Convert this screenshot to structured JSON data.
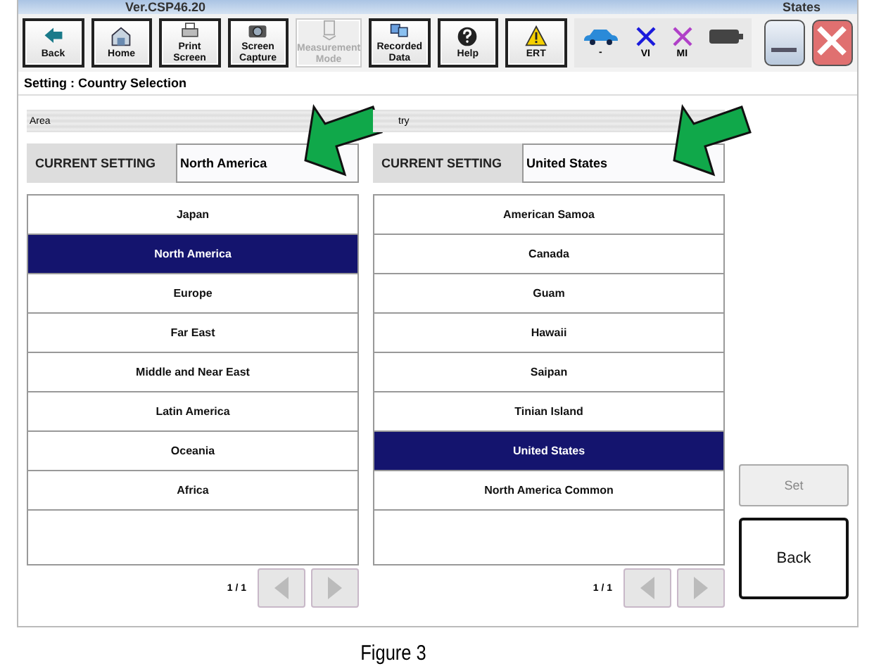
{
  "window": {
    "title": "Ver.CSP46.20",
    "title_right": "States"
  },
  "toolbar": [
    {
      "label": "Back",
      "kind": "back",
      "disabled": false
    },
    {
      "label": "Home",
      "kind": "home",
      "disabled": false
    },
    {
      "label": "Print Screen",
      "kind": "print",
      "disabled": false
    },
    {
      "label": "Screen Capture",
      "kind": "camera",
      "disabled": false
    },
    {
      "label": "Measurement Mode",
      "kind": "measure",
      "disabled": true
    },
    {
      "label": "Recorded Data",
      "kind": "data",
      "disabled": false
    },
    {
      "label": "Help",
      "kind": "help",
      "disabled": false
    },
    {
      "label": "ERT",
      "kind": "warning",
      "disabled": false
    }
  ],
  "status": [
    {
      "kind": "car",
      "label": "-"
    },
    {
      "kind": "x",
      "label": "VI",
      "color": "#1a1adc"
    },
    {
      "kind": "x",
      "label": "MI",
      "color": "#b040c8"
    },
    {
      "kind": "battery"
    }
  ],
  "screen_title": "Setting : Country Selection",
  "panels": [
    {
      "header": "Area",
      "current_label": "CURRENT SETTING",
      "current_value": "North America",
      "page": "1 / 1",
      "items": [
        {
          "label": "Japan",
          "selected": false
        },
        {
          "label": "North America",
          "selected": true
        },
        {
          "label": "Europe",
          "selected": false
        },
        {
          "label": "Far East",
          "selected": false
        },
        {
          "label": "Middle and Near East",
          "selected": false
        },
        {
          "label": "Latin America",
          "selected": false
        },
        {
          "label": "Oceania",
          "selected": false
        },
        {
          "label": "Africa",
          "selected": false
        }
      ]
    },
    {
      "header": "try",
      "current_label": "CURRENT SETTING",
      "current_value": "United States",
      "page": "1 / 1",
      "items": [
        {
          "label": "American Samoa",
          "selected": false
        },
        {
          "label": "Canada",
          "selected": false
        },
        {
          "label": "Guam",
          "selected": false
        },
        {
          "label": "Hawaii",
          "selected": false
        },
        {
          "label": "Saipan",
          "selected": false
        },
        {
          "label": "Tinian Island",
          "selected": false
        },
        {
          "label": "United States",
          "selected": true
        },
        {
          "label": "North America Common",
          "selected": false
        }
      ]
    }
  ],
  "actions": [
    {
      "label": "Set",
      "disabled": true
    },
    {
      "label": "Back",
      "disabled": false
    }
  ],
  "caption": "Figure 3"
}
